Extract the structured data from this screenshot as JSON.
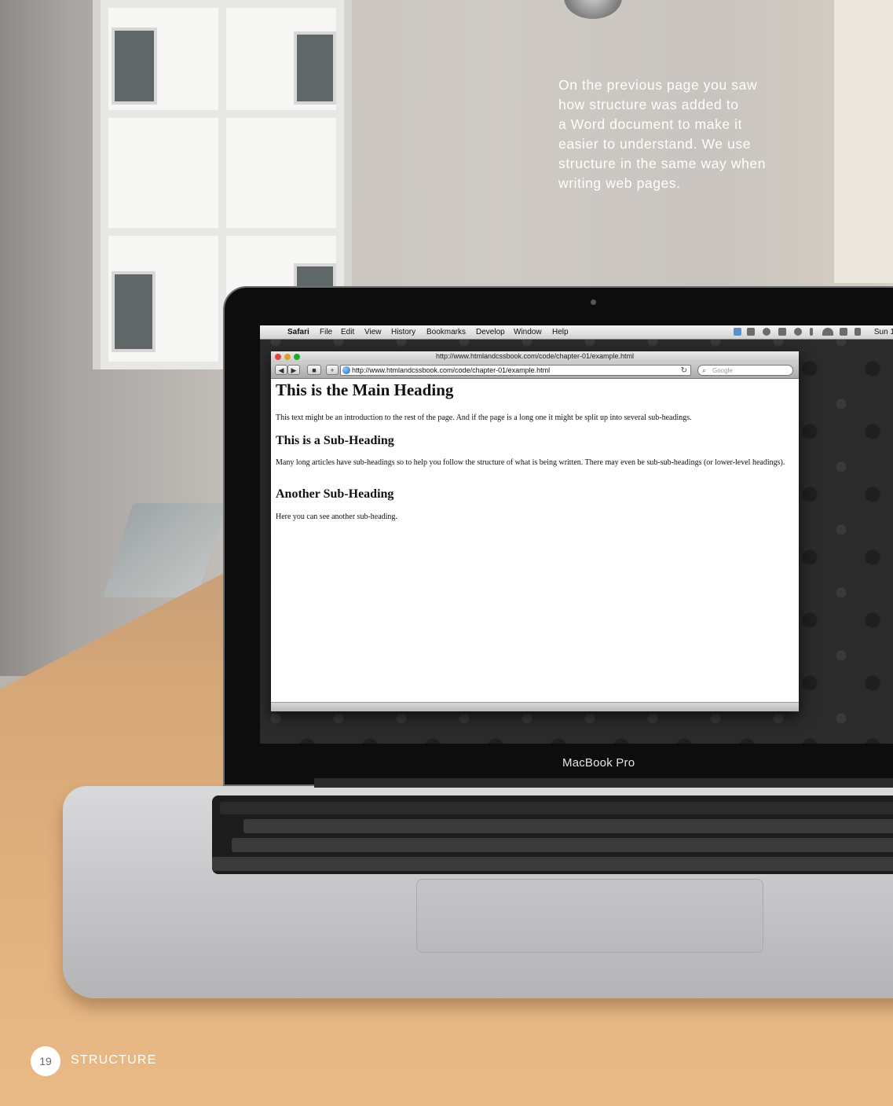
{
  "intro_text": "On the previous page you saw\nhow structure was added to\na Word document to make it\neasier to understand. We use\nstructure in the same way when\nwriting web pages.",
  "laptop": {
    "brand": "MacBook Pro"
  },
  "menubar": {
    "items": [
      "Safari",
      "File",
      "Edit",
      "View",
      "History",
      "Bookmarks",
      "Develop",
      "Window",
      "Help"
    ],
    "clock": "Sun 1"
  },
  "browser": {
    "window_title": "http://www.htmlandcssbook.com/code/chapter-01/example.html",
    "address": "http://www.htmlandcssbook.com/code/chapter-01/example.html",
    "search_placeholder": "Google",
    "traffic_colors": [
      "#e0443e",
      "#dea123",
      "#1aab29"
    ]
  },
  "webpage": {
    "main_heading": "This is the Main Heading",
    "intro_paragraph": "This text might be an introduction to the rest of the page. And if the page is a long one it might be split up into several sub-headings.",
    "sub_heading_1": "This is a Sub-Heading",
    "paragraph_1": "Many long articles have sub-headings so to help you follow the structure of what is being written. There may even be sub-sub-headings (or lower-level headings).",
    "sub_heading_2": "Another Sub-Heading",
    "paragraph_2": "Here you can see another sub-heading."
  },
  "folio": {
    "page_number": "19",
    "section": "STRUCTURE"
  }
}
